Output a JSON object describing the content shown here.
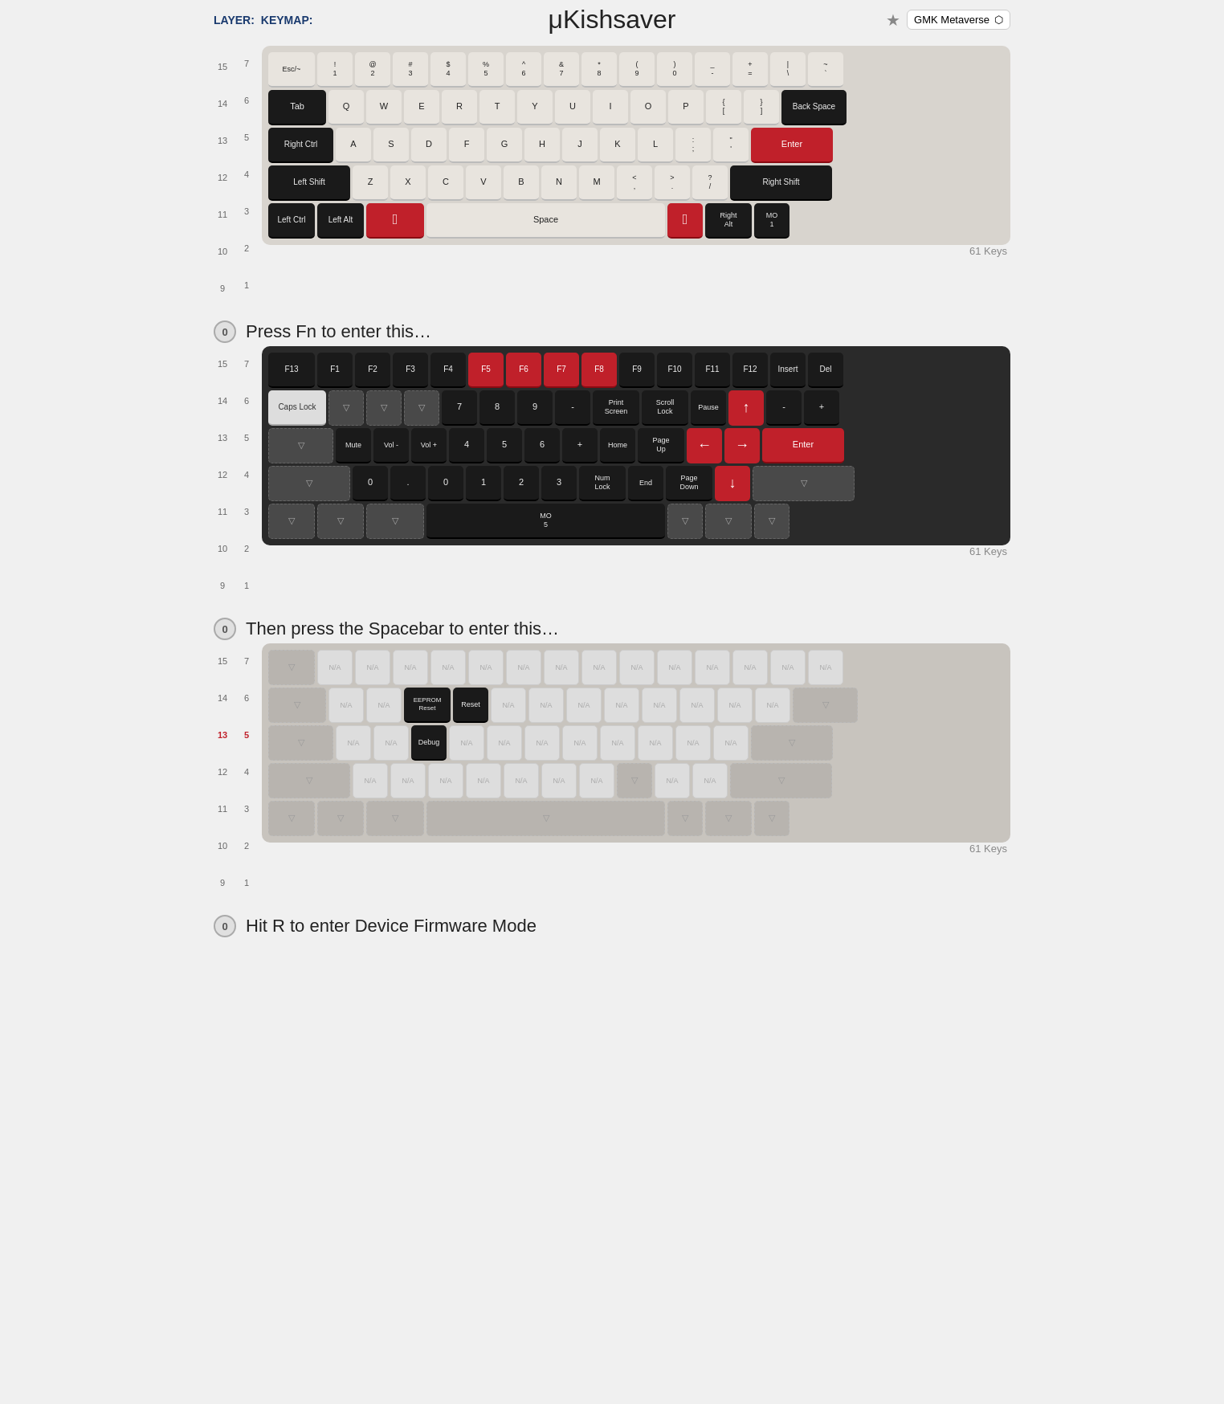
{
  "header": {
    "layer_label": "LAYER:",
    "keymap_label": "KEYMAP:",
    "title": "μKishsaver",
    "star_icon": "★",
    "preset": "GMK Metaverse"
  },
  "sections": [
    {
      "layer_num": "0",
      "layer_active": false,
      "description": "Press Fn to enter this…",
      "key_count": "61 Keys",
      "keyboard_style": "mixed"
    },
    {
      "layer_num": "0",
      "layer_active": false,
      "description": "Then press the Spacebar to enter this…",
      "key_count": "61 Keys",
      "keyboard_style": "dark"
    },
    {
      "layer_num": "0",
      "layer_active": false,
      "description": "Hit R to enter Device Firmware Mode",
      "key_count": ""
    }
  ]
}
